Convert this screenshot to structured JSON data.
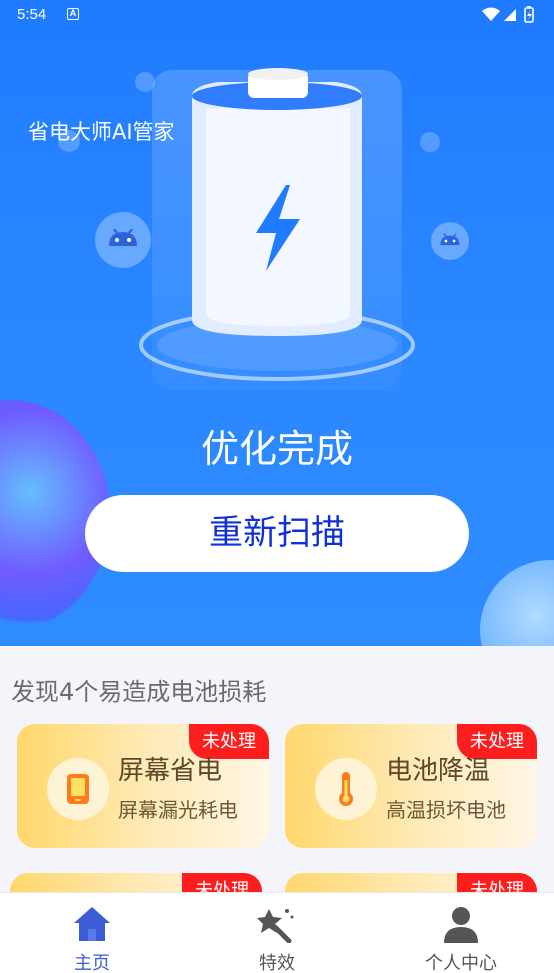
{
  "status_bar": {
    "time": "5:54",
    "notification_icon": "A"
  },
  "app": {
    "title": "省电大师AI管家"
  },
  "hero": {
    "status_text": "优化完成",
    "rescan_label": "重新扫描"
  },
  "issues": {
    "title": "发现4个易造成电池损耗",
    "cards": [
      {
        "title": "屏幕省电",
        "subtitle": "屏幕漏光耗电",
        "badge": "未处理",
        "icon": "tablet-icon"
      },
      {
        "title": "电池降温",
        "subtitle": "高温损坏电池",
        "badge": "未处理",
        "icon": "thermometer-icon"
      },
      {
        "title": "",
        "subtitle": "",
        "badge": "未处理",
        "icon": ""
      },
      {
        "title": "",
        "subtitle": "",
        "badge": "未处理",
        "icon": ""
      }
    ]
  },
  "tab_bar": {
    "tabs": [
      {
        "label": "主页",
        "icon": "home-icon",
        "active": true
      },
      {
        "label": "特效",
        "icon": "magic-wand-icon",
        "active": false
      },
      {
        "label": "个人中心",
        "icon": "user-icon",
        "active": false
      }
    ]
  },
  "colors": {
    "hero_blue": "#1e7bff",
    "button_text": "#1030d6",
    "badge_red": "#ff1e1e",
    "active_tab": "#3c5bd6"
  }
}
